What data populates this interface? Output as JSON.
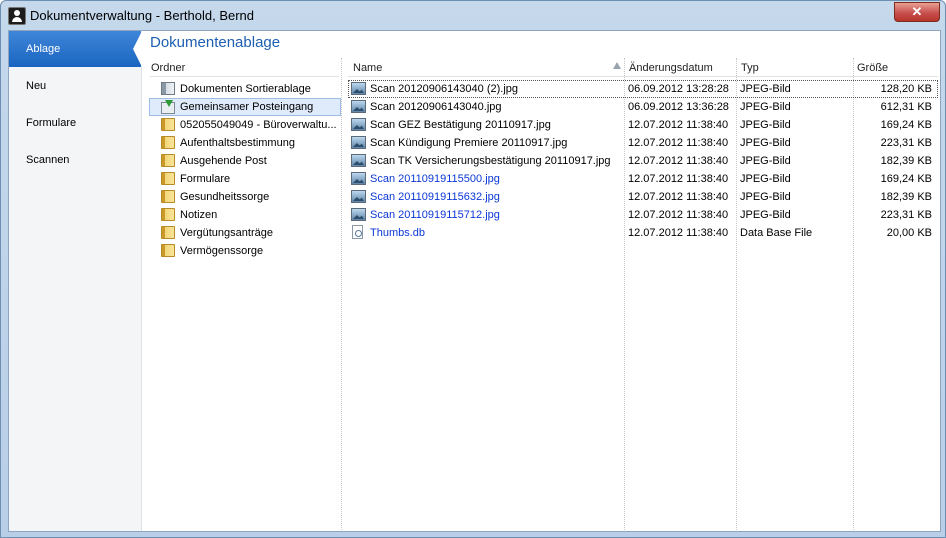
{
  "window": {
    "title": "Dokumentverwaltung - Berthold, Bernd",
    "close_label": "✕"
  },
  "sidebar": {
    "items": [
      {
        "label": "Ablage",
        "active": true
      },
      {
        "label": "Neu",
        "active": false
      },
      {
        "label": "Formulare",
        "active": false
      },
      {
        "label": "Scannen",
        "active": false
      }
    ]
  },
  "main": {
    "title": "Dokumentenablage"
  },
  "folders": {
    "header": "Ordner",
    "items": [
      {
        "label": "Dokumenten Sortierablage",
        "icon": "sorter-icon"
      },
      {
        "label": "Gemeinsamer Posteingang",
        "icon": "inbox-icon",
        "selected": true
      },
      {
        "label": "052055049049 - Büroverwaltu...",
        "icon": "folder-icon"
      },
      {
        "label": "Aufenthaltsbestimmung",
        "icon": "folder-icon"
      },
      {
        "label": "Ausgehende Post",
        "icon": "folder-icon"
      },
      {
        "label": "Formulare",
        "icon": "folder-icon"
      },
      {
        "label": "Gesundheitssorge",
        "icon": "folder-icon"
      },
      {
        "label": "Notizen",
        "icon": "folder-icon"
      },
      {
        "label": "Vergütungsanträge",
        "icon": "folder-icon"
      },
      {
        "label": "Vermögenssorge",
        "icon": "folder-icon"
      }
    ]
  },
  "files": {
    "columns": {
      "name": "Name",
      "date": "Änderungsdatum",
      "type": "Typ",
      "size": "Größe"
    },
    "rows": [
      {
        "name": "Scan 20120906143040 (2).jpg",
        "date": "06.09.2012 13:28:28",
        "type": "JPEG-Bild",
        "size": "128,20 KB"
      },
      {
        "name": "Scan 20120906143040.jpg",
        "date": "06.09.2012 13:36:28",
        "type": "JPEG-Bild",
        "size": "612,31 KB"
      },
      {
        "name": "Scan GEZ Bestätigung 20110917.jpg",
        "date": "12.07.2012 11:38:40",
        "type": "JPEG-Bild",
        "size": "169,24 KB"
      },
      {
        "name": "Scan Kündigung Premiere 20110917.jpg",
        "date": "12.07.2012 11:38:40",
        "type": "JPEG-Bild",
        "size": "223,31 KB"
      },
      {
        "name": "Scan TK Versicherungsbestätigung 20110917.jpg",
        "date": "12.07.2012 11:38:40",
        "type": "JPEG-Bild",
        "size": "182,39 KB"
      },
      {
        "name": "Scan 20110919115500.jpg",
        "date": "12.07.2012 11:38:40",
        "type": "JPEG-Bild",
        "size": "169,24 KB"
      },
      {
        "name": "Scan 20110919115632.jpg",
        "date": "12.07.2012 11:38:40",
        "type": "JPEG-Bild",
        "size": "182,39 KB"
      },
      {
        "name": "Scan 20110919115712.jpg",
        "date": "12.07.2012 11:38:40",
        "type": "JPEG-Bild",
        "size": "223,31 KB"
      },
      {
        "name": "Thumbs.db",
        "date": "12.07.2012 11:38:40",
        "type": "Data Base File",
        "size": "20,00 KB"
      }
    ]
  },
  "colors": {
    "accent": "#1a65c0",
    "title_blue": "#1d5fb0",
    "link_blue": "#0b37d6"
  }
}
